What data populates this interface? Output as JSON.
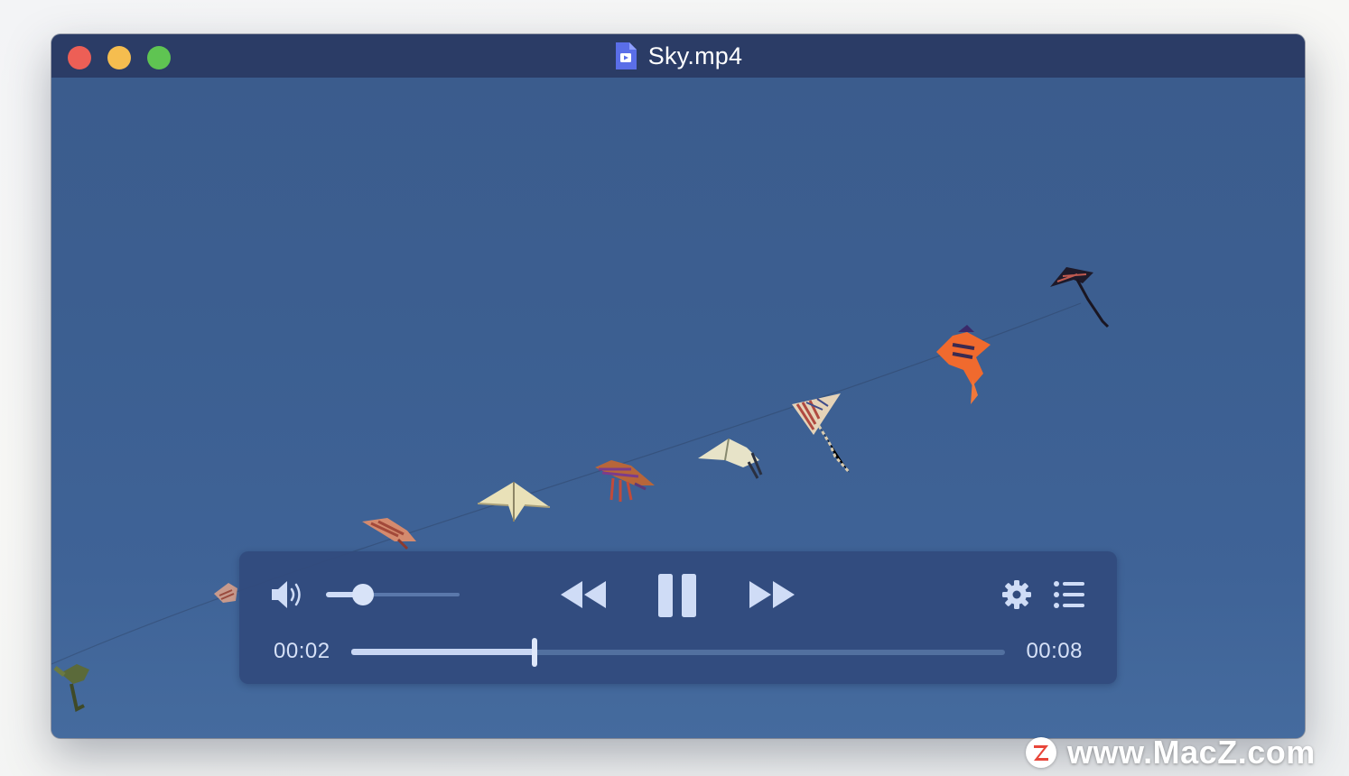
{
  "window": {
    "title": "Sky.mp4",
    "title_icon": "video-document-icon",
    "traffic_lights": [
      {
        "name": "close",
        "color": "#ed5f56"
      },
      {
        "name": "minimize",
        "color": "#f5bd4f"
      },
      {
        "name": "zoom",
        "color": "#5fc452"
      }
    ]
  },
  "player": {
    "volume_level": 0.28,
    "progress": 0.28,
    "elapsed_time": "00:02",
    "total_time": "00:08",
    "icons": {
      "volume": "speaker-volume-icon",
      "rewind": "rewind-icon",
      "play_pause": "pause-icon",
      "fast_forward": "fast-forward-icon",
      "settings": "gear-icon",
      "playlist": "playlist-icon"
    }
  },
  "colors": {
    "titlebar": "#2b3c66",
    "controls_panel": "#314a7d",
    "accent": "#cfdcf6",
    "sky": "#3c5f91"
  },
  "watermark": {
    "logo": "Z",
    "text": "www.MacZ.com"
  }
}
